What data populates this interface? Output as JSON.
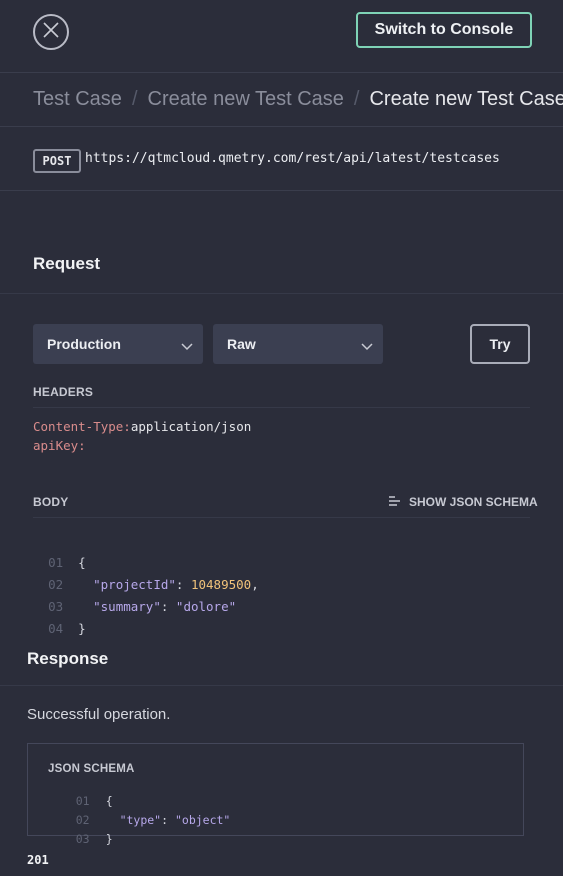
{
  "topbar": {
    "switch_label": "Switch to Console"
  },
  "breadcrumb": {
    "items": [
      "Test Case",
      "Create new Test Case",
      "Create new Test Case"
    ],
    "separator": "/"
  },
  "endpoint": {
    "method": "POST",
    "url": "https://qtmcloud.qmetry.com/rest/api/latest/testcases"
  },
  "request": {
    "title": "Request",
    "environment": "Production",
    "body_format": "Raw",
    "try_label": "Try",
    "headers_label": "HEADERS",
    "headers": [
      {
        "key": "Content-Type:",
        "value": "application/json"
      },
      {
        "key": "apiKey:",
        "value": ""
      }
    ],
    "body_label": "BODY",
    "schema_link": "SHOW JSON SCHEMA",
    "body_lines": [
      {
        "num": "01",
        "open": "{"
      },
      {
        "num": "02",
        "key": "\"projectId\"",
        "sep": ": ",
        "number": "10489500",
        "end": ","
      },
      {
        "num": "03",
        "key": "\"summary\"",
        "sep": ": ",
        "string": "\"dolore\""
      },
      {
        "num": "04",
        "close": "}"
      }
    ]
  },
  "response": {
    "title": "Response",
    "description": "Successful operation.",
    "schema_label": "JSON SCHEMA",
    "schema_lines": [
      {
        "num": "01",
        "open": "{"
      },
      {
        "num": "02",
        "key": "\"type\"",
        "sep": ": ",
        "string": "\"object\""
      },
      {
        "num": "03",
        "close": "}"
      }
    ],
    "status_code": "201"
  },
  "colors": {
    "background": "#2b2d3a",
    "accent_green": "#7fd3b6",
    "header_key": "#d98c8c",
    "json_string": "#b7a8ea",
    "json_number": "#f0c27a"
  },
  "icons": [
    "close-icon",
    "chevron-down-icon",
    "schema-list-icon"
  ]
}
